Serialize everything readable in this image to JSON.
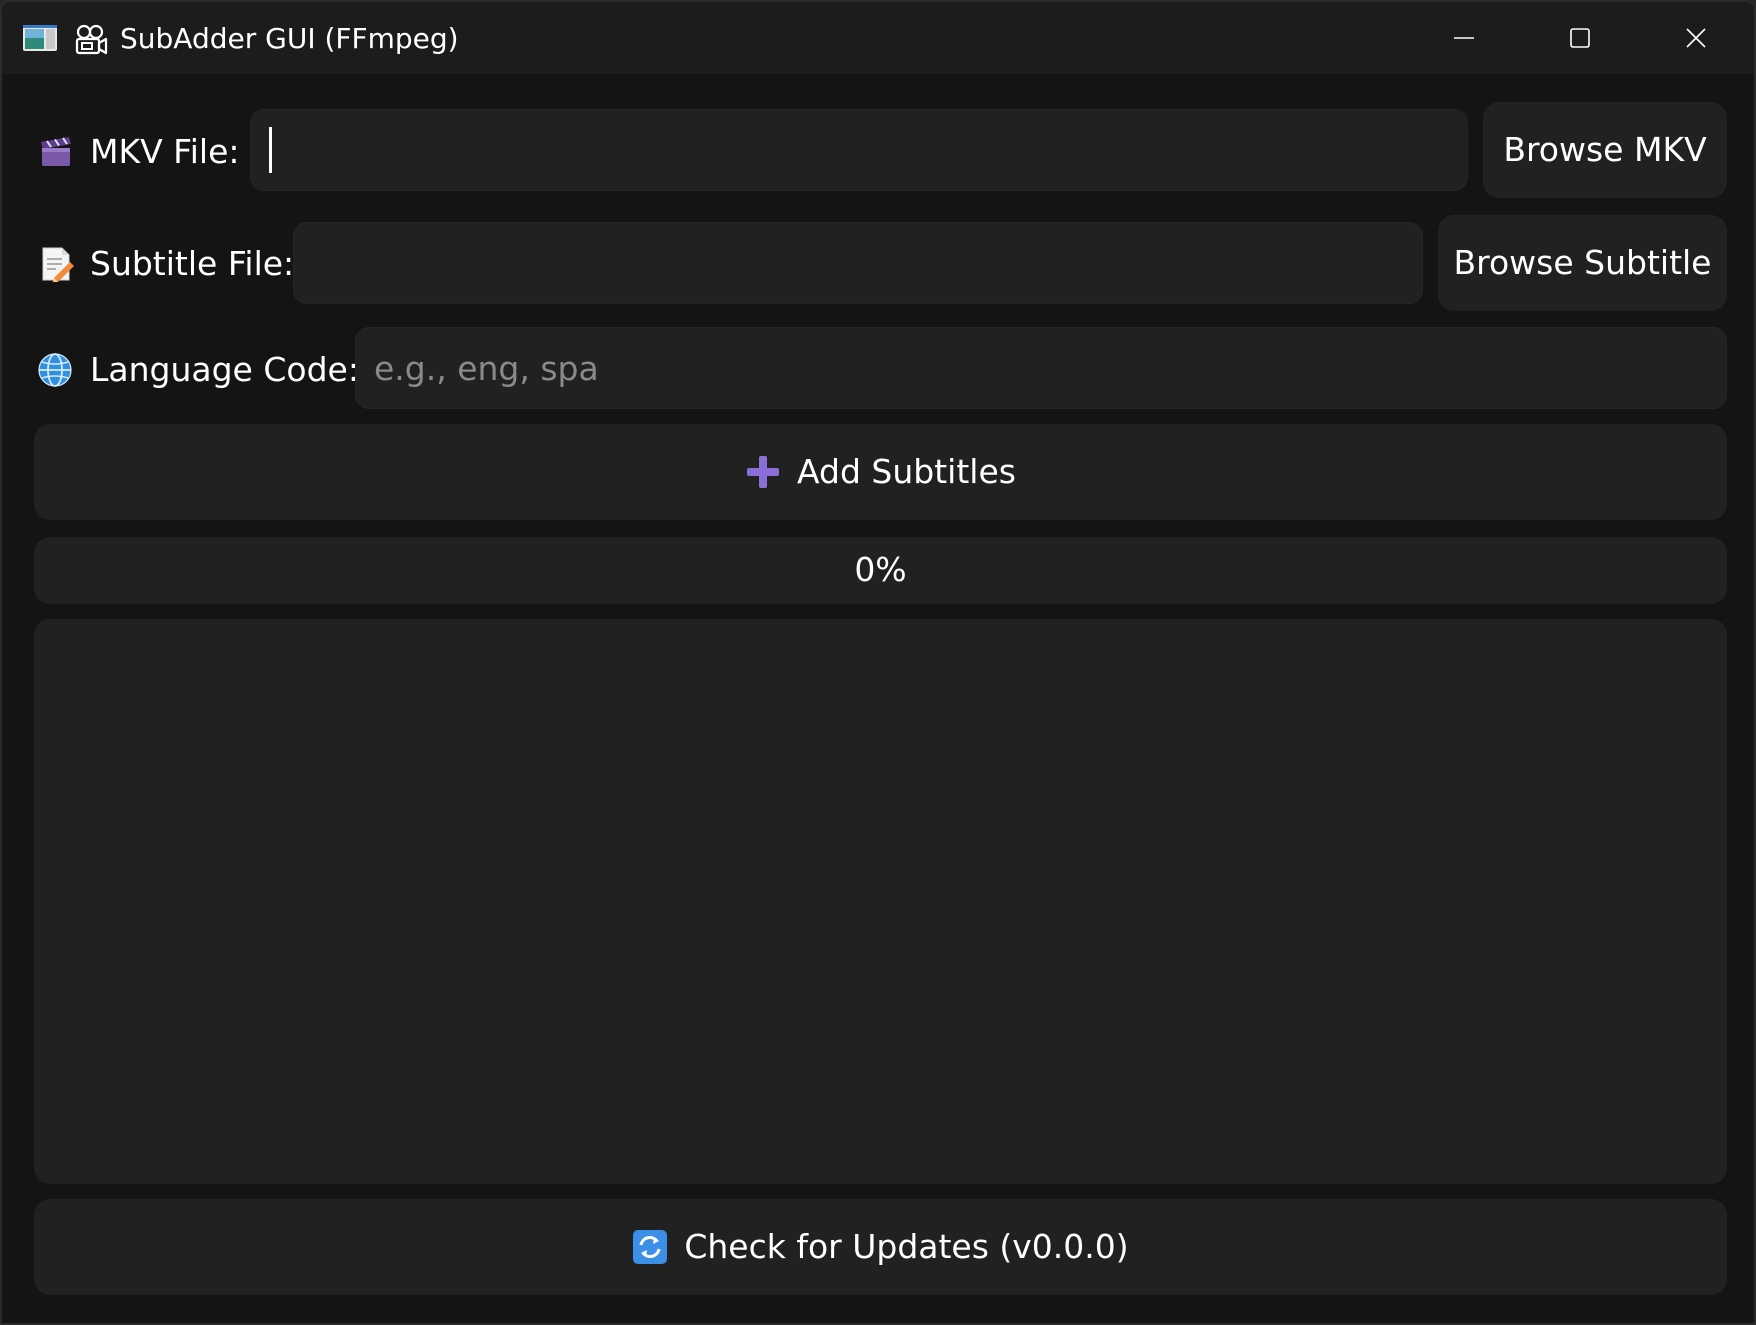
{
  "window": {
    "title": "SubAdder GUI (FFmpeg)",
    "controls": {
      "minimize_icon": "minimize-icon",
      "maximize_icon": "maximize-icon",
      "close_icon": "close-icon"
    }
  },
  "form": {
    "mkv": {
      "icon": "clapper-board-icon",
      "label": "MKV File:",
      "value": "",
      "browse_label": "Browse MKV"
    },
    "subtitle": {
      "icon": "memo-icon",
      "label": "Subtitle File:",
      "value": "",
      "browse_label": "Browse Subtitle"
    },
    "language": {
      "icon": "globe-icon",
      "label": "Language Code:",
      "value": "",
      "placeholder": "e.g., eng, spa"
    }
  },
  "actions": {
    "add_subtitles": {
      "icon": "plus-icon",
      "label": "Add Subtitles"
    },
    "check_updates": {
      "icon": "refresh-icon",
      "label": "Check for Updates (v0.0.0)"
    }
  },
  "progress": {
    "value": 0,
    "text": "0%"
  },
  "log": {
    "text": ""
  },
  "colors": {
    "window_bg": "#141414",
    "field_bg": "#212121",
    "text": "#ffffff",
    "placeholder": "#8a8a8a",
    "plus_accent": "#8b6fd6",
    "refresh_accent": "#3b8fe6"
  }
}
